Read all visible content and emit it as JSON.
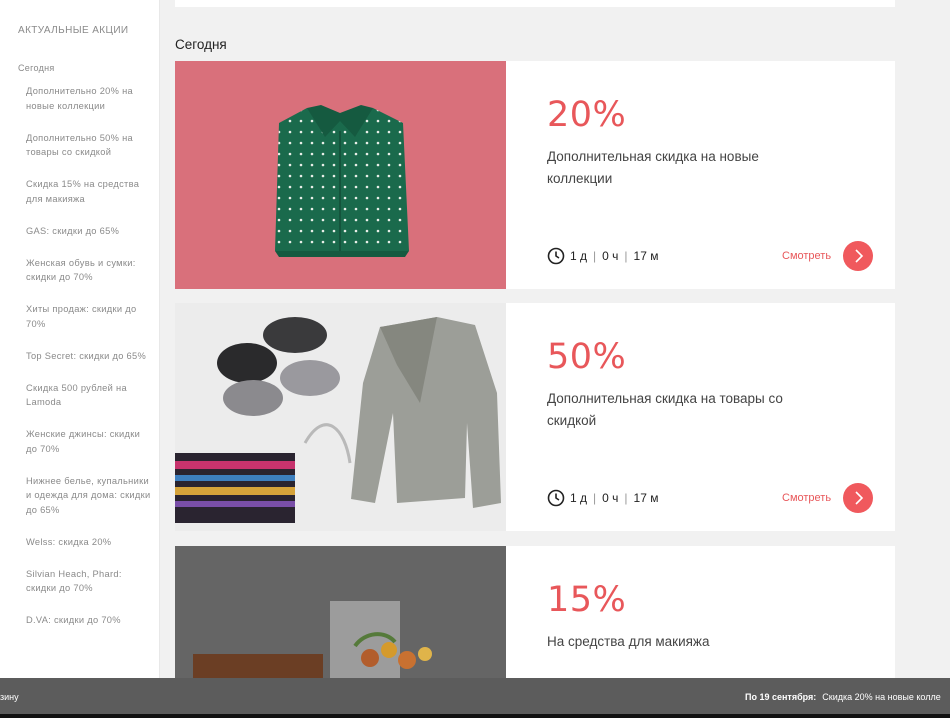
{
  "sidebar": {
    "title": "АКТУАЛЬНЫЕ АКЦИИ",
    "section": "Сегодня",
    "items": [
      "Дополнительно 20% на новые коллекции",
      "Дополнительно 50% на товары со скидкой",
      "Скидка 15% на средства для макияжа",
      "GAS: скидки до 65%",
      "Женская обувь и сумки: скидки до 70%",
      "Хиты продаж: скидки до 70%",
      "Top Secret: скидки до 65%",
      "Скидка 500 рублей на Lamoda",
      "Женские джинсы: скидки до 70%",
      "Нижнее белье, купальники и одежда для дома: скидки до 65%",
      "Welss: скидка 20%",
      "Silvian Heach, Phard: скидки до 70%",
      "D.VA: скидки до 70%"
    ]
  },
  "main": {
    "heading": "Сегодня",
    "cards": [
      {
        "percent": "20%",
        "description": "Дополнительная скидка на новые коллекции",
        "timer": {
          "days": "1 д",
          "hours": "0 ч",
          "minutes": "17 м"
        },
        "link": "Смотреть"
      },
      {
        "percent": "50%",
        "description": "Дополнительная скидка на товары со скидкой",
        "timer": {
          "days": "1 д",
          "hours": "0 ч",
          "minutes": "17 м"
        },
        "link": "Смотреть"
      },
      {
        "percent": "15%",
        "description": "На средства для макияжа"
      }
    ]
  },
  "bottom_bar": {
    "left_text": "зину",
    "right_bold": "По 19 сентября:",
    "right_text": "Скидка 20% на новые колле"
  },
  "colors": {
    "accent": "#e8575a",
    "card1_bg": "#d9707b",
    "bar": "#5c5c5c"
  }
}
